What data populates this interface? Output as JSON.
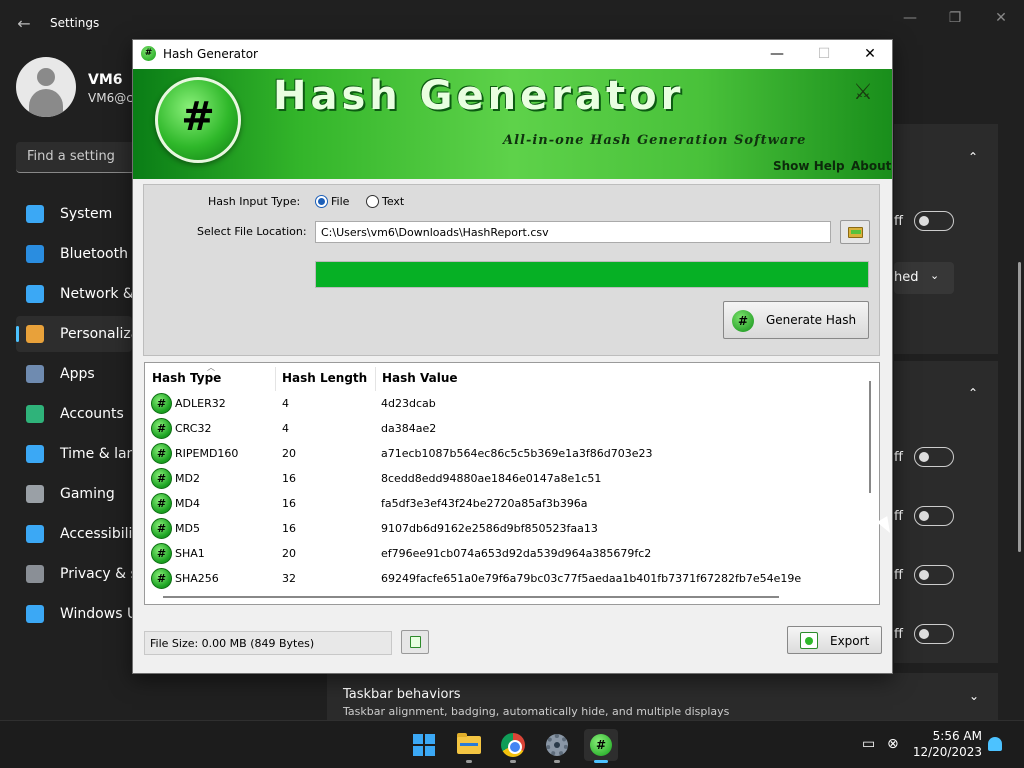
{
  "settings": {
    "title": "Settings",
    "profile": {
      "name": "VM6",
      "email": "VM6@c"
    },
    "search_placeholder": "Find a setting",
    "nav": [
      {
        "label": "System",
        "icon": "monitor-icon",
        "color": "#3ba8f5"
      },
      {
        "label": "Bluetooth &",
        "icon": "bluetooth-icon",
        "color": "#2a8de0"
      },
      {
        "label": "Network &",
        "icon": "wifi-icon",
        "color": "#3ba8f5"
      },
      {
        "label": "Personalizat",
        "icon": "brush-icon",
        "color": "#e8a13a"
      },
      {
        "label": "Apps",
        "icon": "apps-icon",
        "color": "#6f8bb0"
      },
      {
        "label": "Accounts",
        "icon": "account-icon",
        "color": "#2fb37a"
      },
      {
        "label": "Time & lang",
        "icon": "clock-globe-icon",
        "color": "#3ba8f5"
      },
      {
        "label": "Gaming",
        "icon": "gamepad-icon",
        "color": "#9aa0a6"
      },
      {
        "label": "Accessibility",
        "icon": "accessibility-icon",
        "color": "#3ba8f5"
      },
      {
        "label": "Privacy & se",
        "icon": "shield-icon",
        "color": "#8a8f96"
      },
      {
        "label": "Windows U",
        "icon": "update-icon",
        "color": "#3ba8f5"
      }
    ],
    "toggle_fragment": "ff",
    "dropdown_fragment": "hed",
    "taskbar_behaviors": {
      "title": "Taskbar behaviors",
      "subtitle": "Taskbar alignment, badging, automatically hide, and multiple displays"
    }
  },
  "hash_generator": {
    "window_title": "Hash Generator",
    "banner": {
      "logo_glyph": "#",
      "title": "Hash Generator",
      "subtitle": "All-in-one Hash Generation Software",
      "show_help": "Show Help",
      "about": "About"
    },
    "input_type_label": "Hash Input Type:",
    "radio_file": "File",
    "radio_text": "Text",
    "file_location_label": "Select File Location:",
    "file_path": "C:\\Users\\vm6\\Downloads\\HashReport.csv",
    "progress": 1.0,
    "generate_button": "Generate Hash",
    "table": {
      "columns": [
        "Hash Type",
        "Hash Length",
        "Hash Value"
      ],
      "rows": [
        {
          "type": "ADLER32",
          "length": "4",
          "value": "4d23dcab"
        },
        {
          "type": "CRC32",
          "length": "4",
          "value": "da384ae2"
        },
        {
          "type": "RIPEMD160",
          "length": "20",
          "value": "a71ecb1087b564ec86c5c5b369e1a3f86d703e23"
        },
        {
          "type": "MD2",
          "length": "16",
          "value": "8cedd8edd94880ae1846e0147a8e1c51"
        },
        {
          "type": "MD4",
          "length": "16",
          "value": "fa5df3e3ef43f24be2720a85af3b396a"
        },
        {
          "type": "MD5",
          "length": "16",
          "value": "9107db6d9162e2586d9bf850523faa13"
        },
        {
          "type": "SHA1",
          "length": "20",
          "value": "ef796ee91cb074a653d92da539d964a385679fc2"
        },
        {
          "type": "SHA256",
          "length": "32",
          "value": "69249facfe651a0e79f6a79bc03c77f5aedaa1b401fb7371f67282fb7e54e19e"
        }
      ]
    },
    "file_size": "File Size: 0.00 MB (849 Bytes)",
    "export_button": "Export"
  },
  "taskbar": {
    "apps": [
      "start-button",
      "file-explorer",
      "chrome",
      "settings",
      "hash-generator"
    ],
    "time": "5:56 AM",
    "date": "12/20/2023"
  }
}
